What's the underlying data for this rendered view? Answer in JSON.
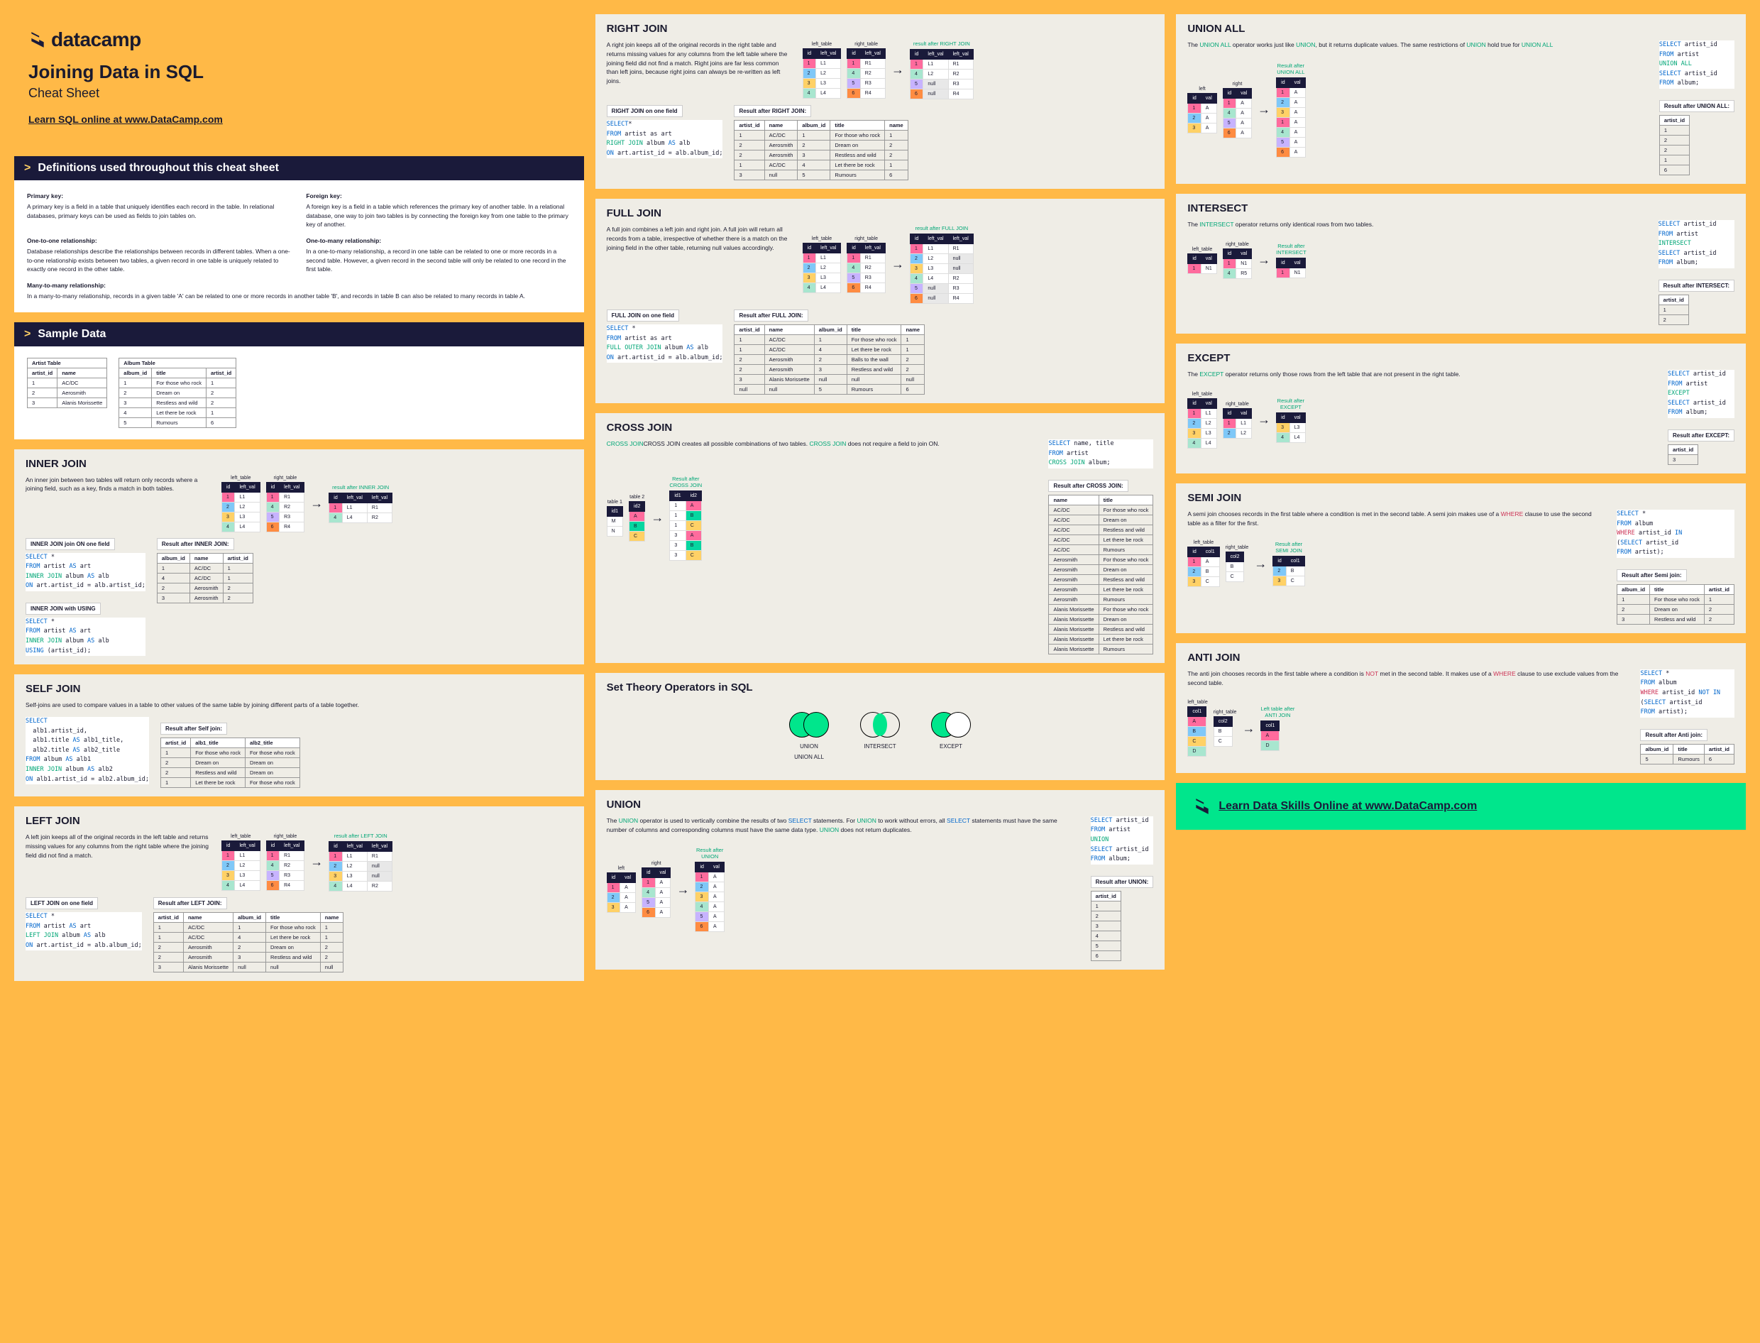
{
  "header": {
    "brand": "datacamp",
    "title": "Joining Data in SQL",
    "subtitle": "Cheat Sheet",
    "learn": "Learn SQL online at www.DataCamp.com"
  },
  "definitions": {
    "heading": "Definitions used throughout this cheat sheet",
    "pk_title": "Primary key:",
    "pk_body": "A primary key is a field in a table that uniquely identifies each record in the table. In relational databases, primary keys can be used as fields to join tables on.",
    "fk_title": "Foreign key:",
    "fk_body": "A foreign key is a field in a table which references the primary key of another table. In a relational database, one way to join two tables is by connecting the foreign key from one table to the primary key of another.",
    "oo_title": "One-to-one relationship:",
    "oo_body": "Database relationships describe the relationships between records in different tables. When a one-to-one relationship exists between two tables, a given record in one table is uniquely related to exactly one record in the other table.",
    "om_title": "One-to-many relationship:",
    "om_body": "In a one-to-many relationship, a record in one table can be related to one or more records in a second table. However, a given record in the second table will only be related to one record in the first table.",
    "mm_title": "Many-to-many relationship:",
    "mm_body": "In a many-to-many relationship, records in a given table 'A' can be related to one or more records in another table 'B', and records in table B can also be related to many records in table A."
  },
  "sample": {
    "heading": "Sample Data",
    "artist_title": "Artist Table",
    "album_title": "Album Table",
    "artist_cols": [
      "artist_id",
      "name"
    ],
    "artist_rows": [
      [
        "1",
        "AC/DC"
      ],
      [
        "2",
        "Aerosmith"
      ],
      [
        "3",
        "Alanis Morissette"
      ]
    ],
    "album_cols": [
      "album_id",
      "title",
      "artist_id"
    ],
    "album_rows": [
      [
        "1",
        "For those who rock",
        "1"
      ],
      [
        "2",
        "Dream on",
        "2"
      ],
      [
        "3",
        "Restless and wild",
        "2"
      ],
      [
        "4",
        "Let there be rock",
        "1"
      ],
      [
        "5",
        "Rumours",
        "6"
      ]
    ]
  },
  "inner": {
    "title": "INNER JOIN",
    "desc": "An inner join between two tables will return only records where a joining field, such as a key, finds a match in both tables.",
    "left_label": "left_table",
    "right_label": "right_table",
    "cell_cols": [
      "id",
      "left_val"
    ],
    "cell_cols_r": [
      "id",
      "left_val"
    ],
    "result_label": "result after INNER JOIN",
    "result_cols": [
      "id",
      "left_val",
      "left_val"
    ],
    "result_rows": [
      [
        "1",
        "L1",
        "R1"
      ],
      [
        "4",
        "L4",
        "R2"
      ]
    ],
    "sub1": "INNER JOIN join ON one field",
    "sql1": "SELECT *\nFROM artist AS art\nINNER JOIN album AS alb\nON art.artist_id = alb.artist_id;",
    "sub2": "INNER JOIN with USING",
    "sql2": "SELECT *\nFROM artist AS art\nINNER JOIN album AS alb\nUSING (artist_id);",
    "res_title": "Result after INNER JOIN:",
    "res_cols": [
      "album_id",
      "name",
      "artist_id"
    ],
    "res_rows": [
      [
        "1",
        "AC/DC",
        "1"
      ],
      [
        "4",
        "AC/DC",
        "1"
      ],
      [
        "2",
        "Aerosmith",
        "2"
      ],
      [
        "3",
        "Aerosmith",
        "2"
      ]
    ]
  },
  "self": {
    "title": "SELF JOIN",
    "desc": "Self-joins are used to compare values in a table to other values of the same table by joining different parts of a table together.",
    "sql": "SELECT\n  alb1.artist_id,\n  alb1.title AS alb1_title,\n  alb2.title AS alb2_title\nFROM album AS alb1\nINNER JOIN album AS alb2\nON alb1.artist_id = alb2.album_id;",
    "res_title": "Result after Self join:",
    "res_cols": [
      "artist_id",
      "alb1_title",
      "alb2_title"
    ],
    "res_rows": [
      [
        "1",
        "For those who rock",
        "For those who rock"
      ],
      [
        "2",
        "Dream on",
        "Dream on"
      ],
      [
        "2",
        "Restless and wild",
        "Dream on"
      ],
      [
        "1",
        "Let there be rock",
        "For those who rock"
      ]
    ]
  },
  "left": {
    "title": "LEFT JOIN",
    "desc": "A left join keeps all of the original records in the left table and returns missing values for any columns from the right table where the joining field did not find a match.",
    "result_label": "result after LEFT JOIN",
    "sub": "LEFT JOIN on one field",
    "sql": "SELECT *\nFROM artist AS art\nLEFT JOIN album AS alb\nON art.artist_id = alb.album_id;",
    "res_title": "Result after LEFT JOIN:",
    "res_cols": [
      "artist_id",
      "name",
      "album_id",
      "title",
      "name"
    ],
    "res_rows": [
      [
        "1",
        "AC/DC",
        "1",
        "For those who rock",
        "1"
      ],
      [
        "1",
        "AC/DC",
        "4",
        "Let there be rock",
        "1"
      ],
      [
        "2",
        "Aerosmith",
        "2",
        "Dream on",
        "2"
      ],
      [
        "2",
        "Aerosmith",
        "3",
        "Restless and wild",
        "2"
      ],
      [
        "3",
        "Alanis Morissette",
        "null",
        "null",
        "null"
      ]
    ]
  },
  "right": {
    "title": "RIGHT JOIN",
    "desc": "A right join keeps all of the original records in the right table and returns missing values for any columns from the left table where the joining field did not find a match. Right joins are far less common than left joins, because right joins can always be re-written as left joins.",
    "result_label": "result after RIGHT JOIN",
    "sub": "RIGHT JOIN on one field",
    "sql": "SELECT *\nFROM artist as art\nRIGHT JOIN album AS alb\nON art.artist_id = alb.album_id;",
    "res_title": "Result after RIGHT JOIN:",
    "res_cols": [
      "artist_id",
      "name",
      "album_id",
      "title",
      "name"
    ],
    "res_rows": [
      [
        "1",
        "AC/DC",
        "1",
        "For those who rock",
        "1"
      ],
      [
        "2",
        "Aerosmith",
        "2",
        "Dream on",
        "2"
      ],
      [
        "2",
        "Aerosmith",
        "3",
        "Restless and wild",
        "2"
      ],
      [
        "1",
        "AC/DC",
        "4",
        "Let there be rock",
        "1"
      ],
      [
        "3",
        "null",
        "5",
        "Rumours",
        "6"
      ]
    ]
  },
  "full": {
    "title": "FULL JOIN",
    "desc": "A full join combines a left join and right join. A full join will return all records from a table, irrespective of whether there is a match on the joining field in the other table, returning null values accordingly.",
    "result_label": "result after FULL JOIN",
    "sub": "FULL JOIN on one field",
    "sql": "SELECT *\nFROM artist as art\nFULL OUTER JOIN album AS alb\nON art.artist_id = alb.album_id;",
    "res_title": "Result after FULL JOIN:",
    "res_cols": [
      "artist_id",
      "name",
      "album_id",
      "title",
      "name"
    ],
    "res_rows": [
      [
        "1",
        "AC/DC",
        "1",
        "For those who rock",
        "1"
      ],
      [
        "1",
        "AC/DC",
        "4",
        "Let there be rock",
        "1"
      ],
      [
        "2",
        "Aerosmith",
        "2",
        "Balls to the wall",
        "2"
      ],
      [
        "2",
        "Aerosmith",
        "3",
        "Restless and wild",
        "2"
      ],
      [
        "3",
        "Alanis Morissette",
        "null",
        "null",
        "null"
      ],
      [
        "null",
        "null",
        "5",
        "Rumours",
        "6"
      ]
    ]
  },
  "cross": {
    "title": "CROSS JOIN",
    "desc_pre": "CROSS JOIN creates all possible combinations of two tables. ",
    "desc_post": " does not require a field to join ON.",
    "label_t1": "table 1",
    "label_t2": "table 2",
    "result_label": "Result after",
    "result_label2": "CROSS JOIN",
    "sql": "SELECT name, title\nFROM artist\nCROSS JOIN album;",
    "res_title": "Result after CROSS JOIN:",
    "res_cols": [
      "name",
      "title"
    ],
    "res_rows": [
      [
        "AC/DC",
        "For those who rock"
      ],
      [
        "AC/DC",
        "Dream on"
      ],
      [
        "AC/DC",
        "Restless and wild"
      ],
      [
        "AC/DC",
        "Let there be rock"
      ],
      [
        "AC/DC",
        "Rumours"
      ],
      [
        "Aerosmith",
        "For those who rock"
      ],
      [
        "Aerosmith",
        "Dream on"
      ],
      [
        "Aerosmith",
        "Restless and wild"
      ],
      [
        "Aerosmith",
        "Let there be rock"
      ],
      [
        "Aerosmith",
        "Rumours"
      ],
      [
        "Alanis Morissette",
        "For those who rock"
      ],
      [
        "Alanis Morissette",
        "Dream on"
      ],
      [
        "Alanis Morissette",
        "Restless and wild"
      ],
      [
        "Alanis Morissette",
        "Let there be rock"
      ],
      [
        "Alanis Morissette",
        "Rumours"
      ]
    ]
  },
  "settheory": {
    "title": "Set Theory Operators in SQL",
    "v1a": "UNION",
    "v1b": "UNION ALL",
    "v2": "INTERSECT",
    "v3": "EXCEPT"
  },
  "union": {
    "title": "UNION",
    "desc_1": "The ",
    "desc_2": " operator is used to vertically combine the results of two ",
    "desc_3": " statements. For ",
    "desc_4": " to work without errors, all ",
    "desc_5": " statements must have the same number of columns and corresponding columns must have the same data type. ",
    "desc_6": " does not return duplicates.",
    "left_label": "left",
    "right_label": "right",
    "result_label": "Result after",
    "result_label2": "UNION",
    "sql": "SELECT artist_id\nFROM artist\nUNION\nSELECT artist_id\nFROM album;",
    "res_title": "Result after UNION:",
    "res_cols": [
      "artist_id"
    ],
    "res_rows": [
      [
        "1"
      ],
      [
        "2"
      ],
      [
        "3"
      ],
      [
        "4"
      ],
      [
        "5"
      ],
      [
        "6"
      ]
    ]
  },
  "unionall": {
    "title": "UNION ALL",
    "desc_1": "The ",
    "desc_2": " operator works just like ",
    "desc_3": ", but it returns duplicate values. The same restrictions of ",
    "desc_4": " hold true for ",
    "left_label": "left",
    "right_label": "right",
    "result_label": "Result after",
    "result_label2": "UNION ALL",
    "sql": "SELECT artist_id\nFROM artist\nUNION ALL\nSELECT artist_id\nFROM album;",
    "res_title": "Result after UNION ALL:",
    "res_cols": [
      "artist_id"
    ],
    "res_rows": [
      [
        "1"
      ],
      [
        "2"
      ],
      [
        "2"
      ],
      [
        "1"
      ],
      [
        "6"
      ]
    ]
  },
  "intersect": {
    "title": "INTERSECT",
    "desc_1": "The ",
    "desc_2": " operator returns only identical rows from two tables.",
    "left_label": "left_table",
    "right_label": "right_table",
    "result_label": "Result after",
    "result_label2": "INTERSECT",
    "sql": "SELECT artist_id\nFROM artist\nINTERSECT\nSELECT artist_id\nFROM album;",
    "res_title": "Result after INTERSECT:",
    "res_cols": [
      "artist_id"
    ],
    "res_rows": [
      [
        "1"
      ],
      [
        "2"
      ]
    ]
  },
  "except": {
    "title": "EXCEPT",
    "desc_1": "The ",
    "desc_2": " operator returns only those rows from the left table that are not present in the right table.",
    "left_label": "left_table",
    "right_label": "right_table",
    "result_label": "Result after",
    "result_label2": "EXCEPT",
    "sql": "SELECT artist_id\nFROM artist\nEXCEPT\nSELECT artist_id\nFROM album;",
    "res_title": "Result after EXCEPT:",
    "res_cols": [
      "artist_id"
    ],
    "res_rows": [
      [
        "3"
      ]
    ]
  },
  "semi": {
    "title": "SEMI JOIN",
    "desc_1": "A semi join chooses records in the first table where a condition is met in the second table. A semi join makes use of a ",
    "desc_2": " clause to use the second table as a filter for the first.",
    "left_label": "left_table",
    "right_label": "right_table",
    "result_label": "Result after",
    "result_label2": "SEMI JOIN",
    "sql": "SELECT *\nFROM album\nWHERE artist_id IN\n(SELECT artist_id\nFROM artist);",
    "res_title": "Result after Semi join:",
    "res_cols": [
      "album_id",
      "title",
      "artist_id"
    ],
    "res_rows": [
      [
        "1",
        "For those who rock",
        "1"
      ],
      [
        "2",
        "Dream on",
        "2"
      ],
      [
        "3",
        "Restless and wild",
        "2"
      ]
    ]
  },
  "anti": {
    "title": "ANTI JOIN",
    "desc_1": "The anti join chooses records in the first table where a condition is ",
    "desc_2": " met in the second table. It makes use of a ",
    "desc_3": " clause to use exclude values from the second table.",
    "left_label": "left_table",
    "right_label": "right_table",
    "result_label": "Left table after",
    "result_label2": "ANTI JOIN",
    "sql": "SELECT *\nFROM album\nWHERE artist_id NOT IN\n(SELECT artist_id\nFROM artist);",
    "res_title": "Result after Anti join:",
    "res_cols": [
      "album_id",
      "title",
      "artist_id"
    ],
    "res_rows": [
      [
        "5",
        "Rumours",
        "6"
      ]
    ]
  },
  "footer": {
    "text": "Learn Data Skills Online at www.DataCamp.com"
  }
}
